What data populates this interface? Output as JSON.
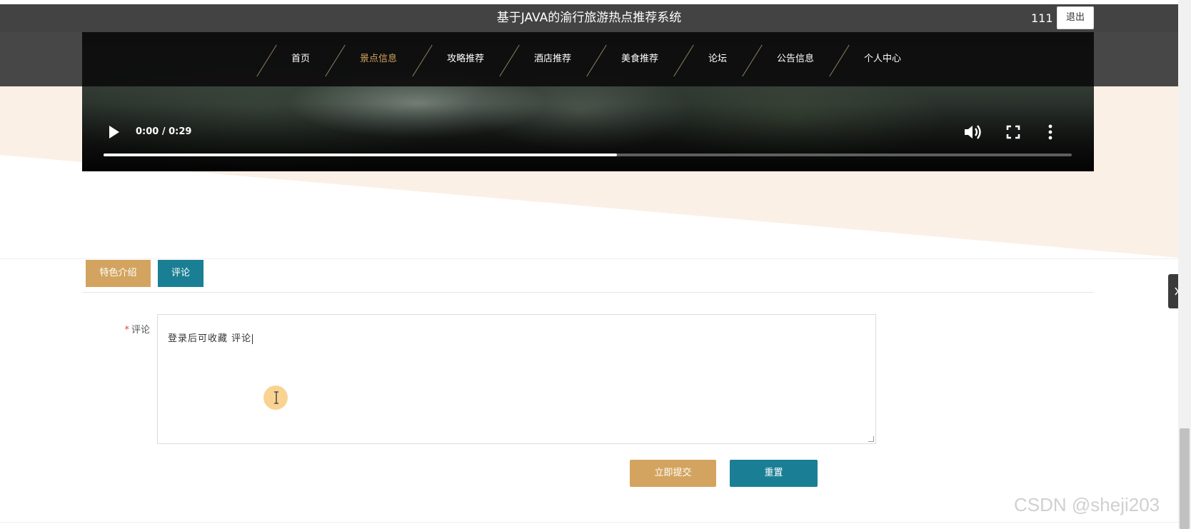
{
  "header": {
    "title": "基于JAVA的渝行旅游热点推荐系统",
    "username": "111",
    "logout_label": "退出"
  },
  "nav": {
    "items": [
      {
        "label": "首页",
        "active": false
      },
      {
        "label": "景点信息",
        "active": true
      },
      {
        "label": "攻略推荐",
        "active": false
      },
      {
        "label": "酒店推荐",
        "active": false
      },
      {
        "label": "美食推荐",
        "active": false
      },
      {
        "label": "论坛",
        "active": false
      },
      {
        "label": "公告信息",
        "active": false
      },
      {
        "label": "个人中心",
        "active": false
      }
    ],
    "active_color": "#d4a35e"
  },
  "video": {
    "time_display": "0:00 / 0:29",
    "progress": 0.53,
    "icons": [
      "play-icon",
      "volume-icon",
      "fullscreen-icon",
      "more-vert-icon"
    ]
  },
  "tabs": [
    {
      "label": "特色介绍",
      "color": "#d3a45f"
    },
    {
      "label": "评论",
      "color": "#1a7f94",
      "selected": true
    }
  ],
  "form": {
    "required_mark": "*",
    "comment_label": "评论",
    "comment_value": "登录后可收藏 评论",
    "submit_label": "立即提交",
    "reset_label": "重置"
  },
  "watermark": "CSDN @sheji203",
  "colors": {
    "accent_gold": "#d3a45f",
    "accent_teal": "#1a7f94",
    "topbar": "#434343"
  }
}
